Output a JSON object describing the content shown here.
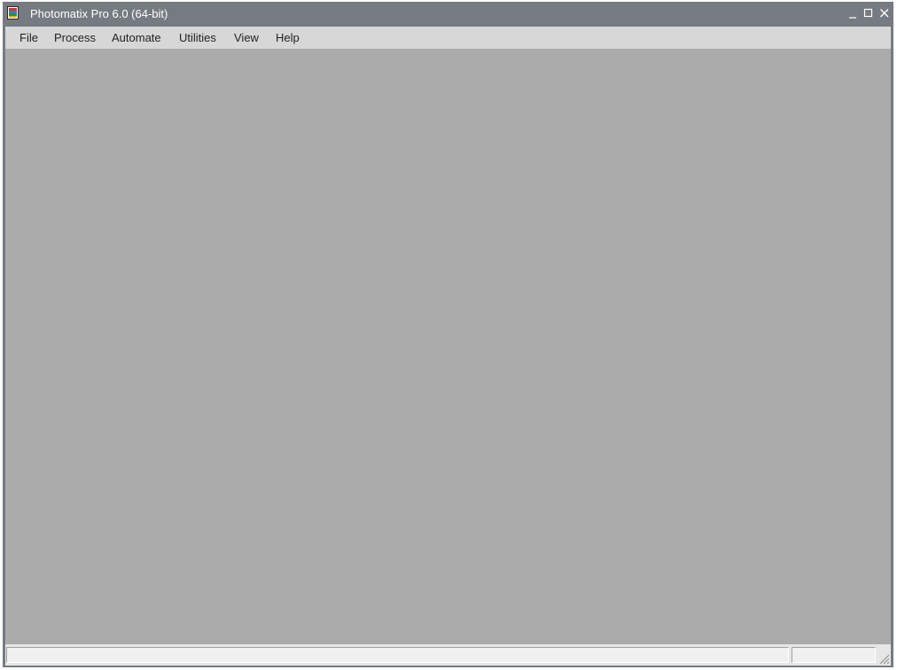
{
  "window": {
    "title": "Photomatix Pro 6.0 (64-bit)",
    "icon": "photomatix-app-icon",
    "controls": [
      "minimize-icon",
      "maximize-icon",
      "close-icon"
    ]
  },
  "menu": {
    "items": [
      {
        "label": "File"
      },
      {
        "label": "Process"
      },
      {
        "label": "Automate"
      },
      {
        "label": "Utilities"
      },
      {
        "label": "View"
      },
      {
        "label": "Help"
      }
    ]
  },
  "status_bar": {
    "main_text": "",
    "secondary_text": ""
  },
  "colors": {
    "titlebar": "#767b82",
    "menubar": "#d7d7d7",
    "workspace": "#ababab",
    "statusbar": "#e6e6e6"
  }
}
